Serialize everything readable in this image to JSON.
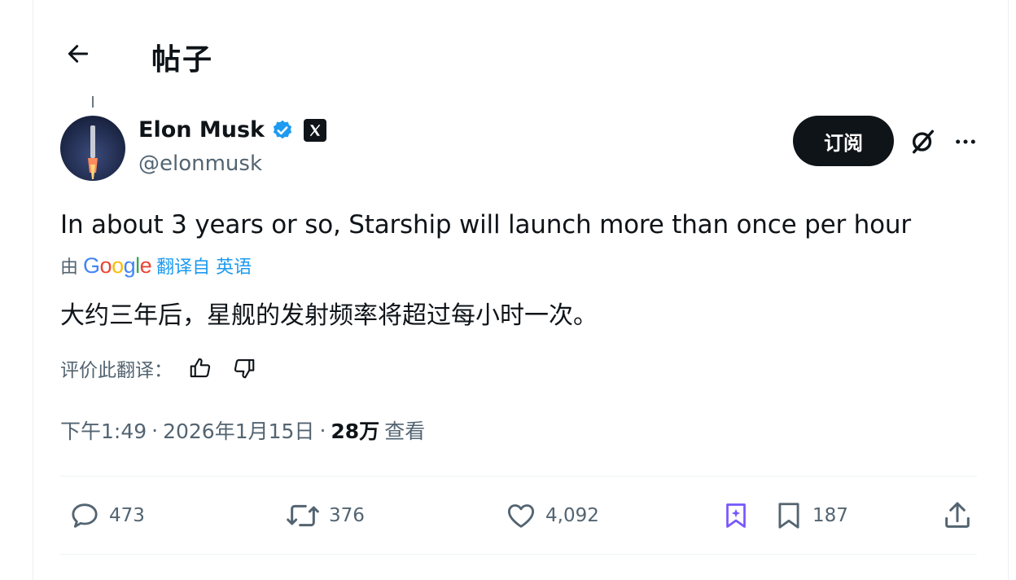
{
  "header": {
    "title": "帖子",
    "back_icon": "arrow-left-icon"
  },
  "author": {
    "name": "Elon Musk",
    "handle": "@elonmusk",
    "verified_icon": "verified-badge-icon",
    "affiliate_icon": "x-logo-icon"
  },
  "actions_top": {
    "subscribe_label": "订阅",
    "grok_icon": "grok-icon",
    "more_icon": "more-horizontal-icon"
  },
  "post": {
    "text": "In about 3 years or so, Starship will launch more than once per hour",
    "translated_by_prefix": "由",
    "translated_by_brand": "Google",
    "translated_from": "翻译自 英语",
    "translated_text": "大约三年后，星舰的发射频率将超过每小时一次。"
  },
  "rating": {
    "label": "评价此翻译：",
    "thumbs_up_icon": "thumbs-up-icon",
    "thumbs_down_icon": "thumbs-down-icon"
  },
  "meta": {
    "time": "下午1:49",
    "sep1": "·",
    "date": "2026年1月15日",
    "sep2": "·",
    "views_count": "28万",
    "views_label": "查看"
  },
  "engagement": {
    "replies": "473",
    "retweets": "376",
    "likes": "4,092",
    "bookmarks": "187"
  },
  "colors": {
    "accent": "#1d9bf0",
    "text_primary": "#0f1419",
    "text_secondary": "#536471",
    "verified": "#1d9bf0",
    "grok_purple": "#7856ff"
  }
}
